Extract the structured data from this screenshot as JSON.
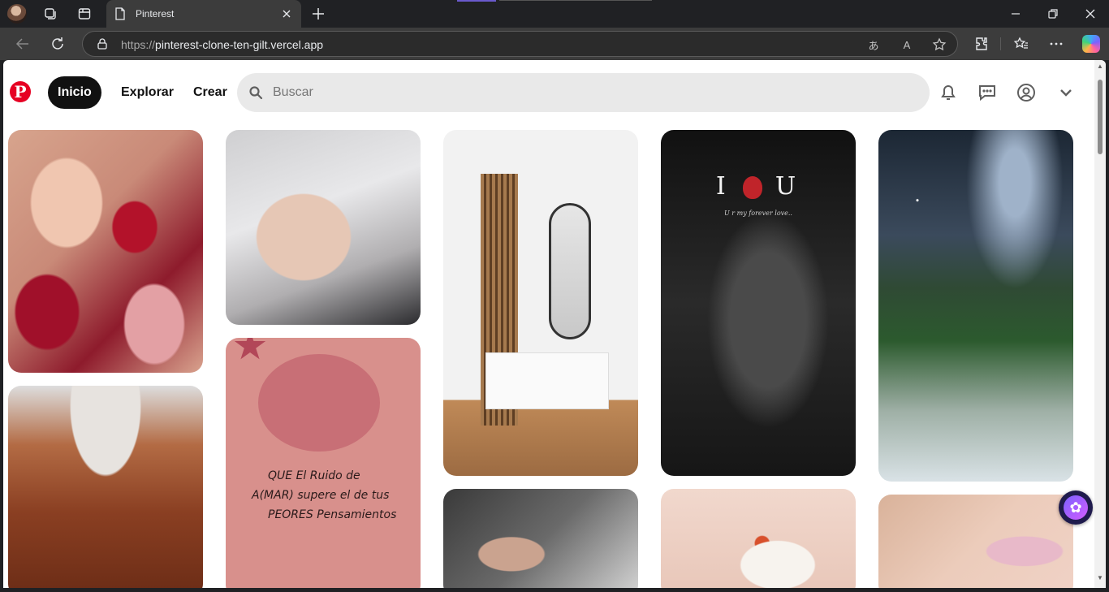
{
  "browser": {
    "tab_title": "Pinterest",
    "url_scheme": "https://",
    "url_host": "pinterest-clone-ten-gilt.vercel.app",
    "omnibox_icons": [
      "translate-icon",
      "read-aloud-icon",
      "favorite-star-icon"
    ],
    "read_aloud_glyph": "A",
    "translate_glyph": "あ"
  },
  "header": {
    "logo_letter": "P",
    "nav": [
      {
        "label": "Inicio",
        "active": true
      },
      {
        "label": "Explorar",
        "active": false
      },
      {
        "label": "Crear",
        "active": false
      }
    ],
    "search_placeholder": "Buscar"
  },
  "pins": [
    {
      "name": "pin-red-nails"
    },
    {
      "name": "pin-black-tip-nails"
    },
    {
      "name": "pin-hallway-mirror"
    },
    {
      "name": "pin-i-love-u"
    },
    {
      "name": "pin-milky-way"
    },
    {
      "name": "pin-red-hair"
    },
    {
      "name": "pin-turtle-quote"
    },
    {
      "name": "pin-wrist-tattoo"
    },
    {
      "name": "pin-cat-tattoo"
    },
    {
      "name": "pin-pink-nails"
    }
  ],
  "pin_texts": {
    "i_love_u": {
      "left": "I",
      "right": "U",
      "caption": "U r my forever love.."
    },
    "quote": {
      "line1": "QUE El Ruido de",
      "line2": "A(MAR) supere el de tus",
      "line3": "PEORES Pensamientos"
    }
  },
  "colors": {
    "brand": "#e60023",
    "active_nav_bg": "#111111",
    "search_bg": "#e9e9e9"
  }
}
